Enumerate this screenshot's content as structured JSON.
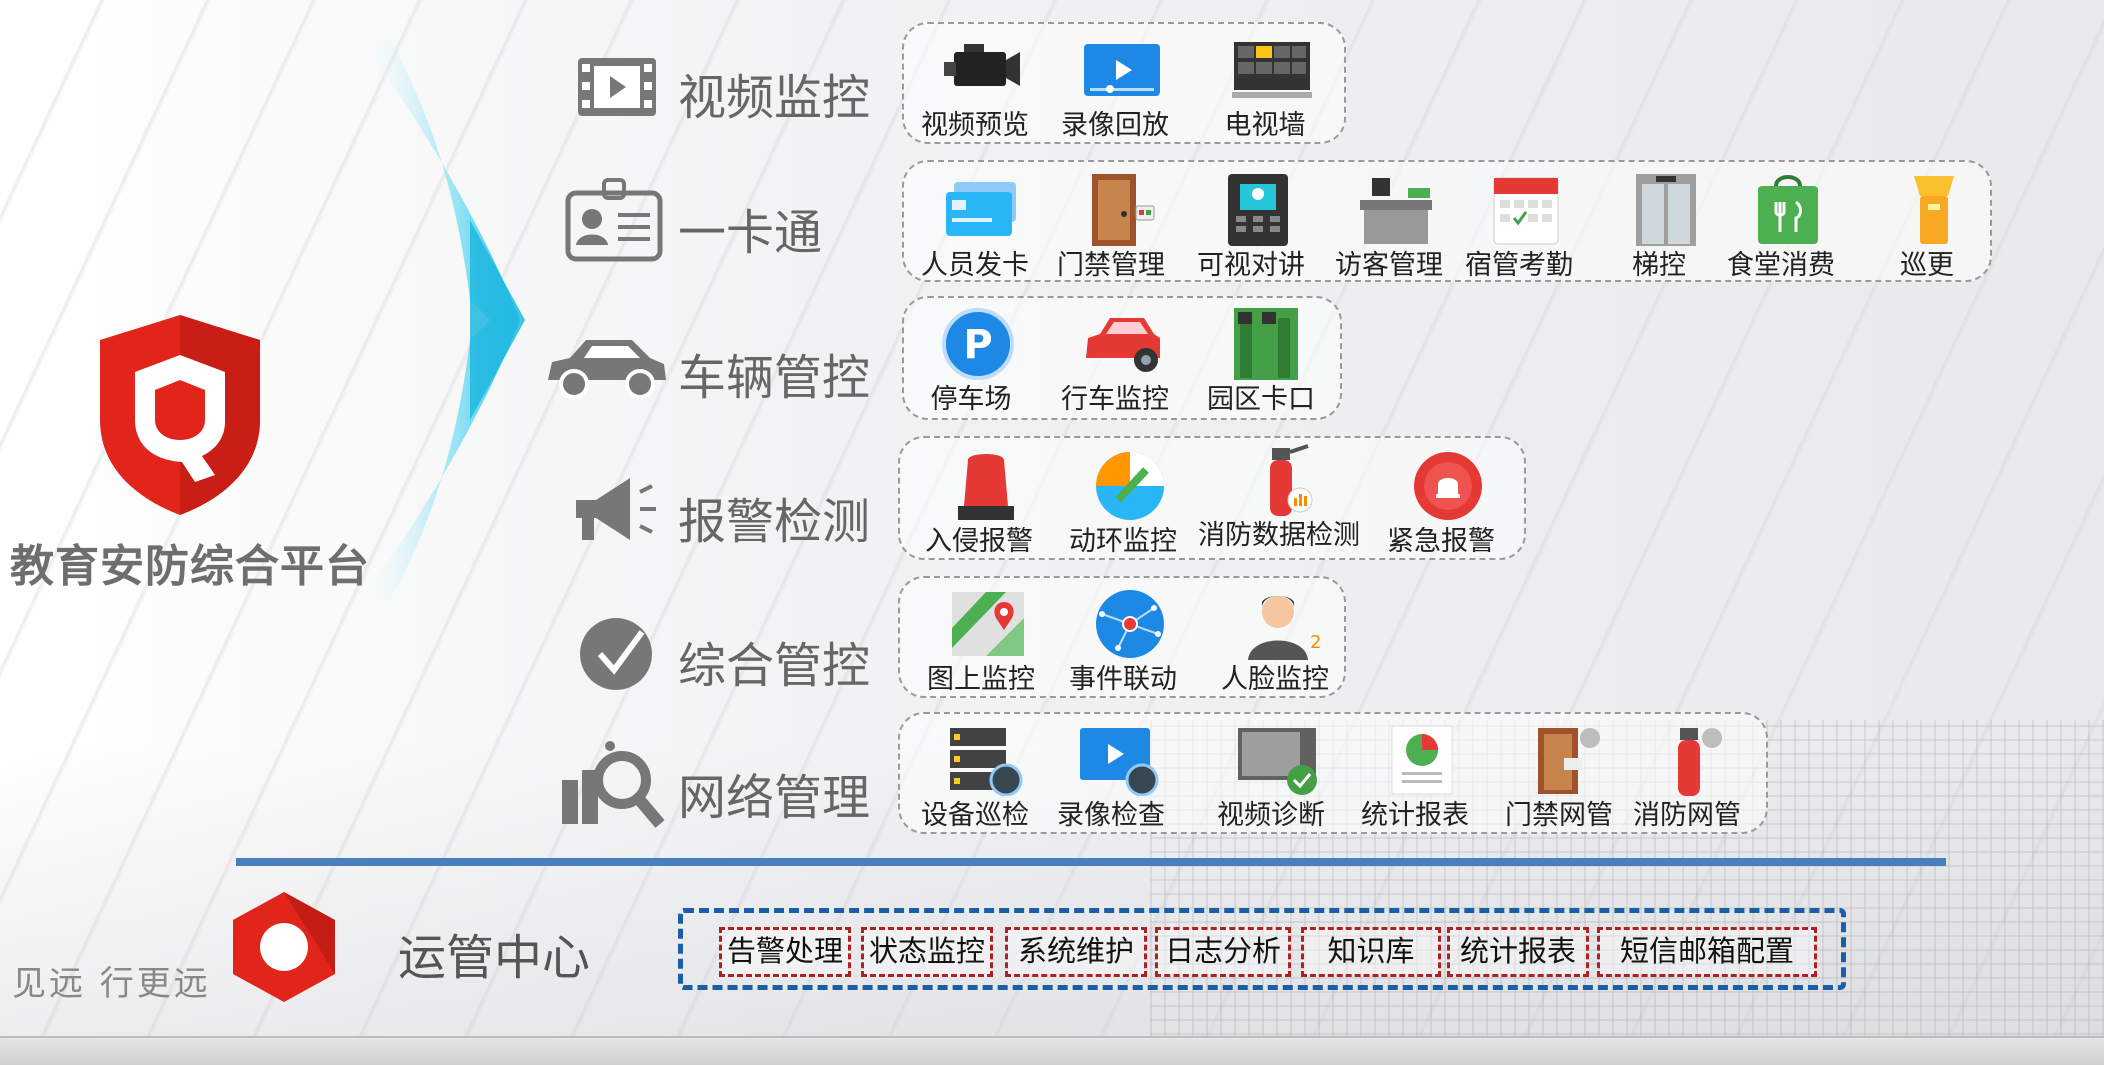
{
  "platform": {
    "title": "教育安防综合平台",
    "slogan": "见远 行更远"
  },
  "categories": [
    {
      "label": "视频监控",
      "icon": "film-icon"
    },
    {
      "label": "一卡通",
      "icon": "id-card-icon"
    },
    {
      "label": "车辆管控",
      "icon": "car-icon"
    },
    {
      "label": "报警检测",
      "icon": "megaphone-icon"
    },
    {
      "label": "综合管控",
      "icon": "check-clock-icon"
    },
    {
      "label": "网络管理",
      "icon": "magnifier-chart-icon"
    }
  ],
  "groups": {
    "video": [
      {
        "label": "视频预览",
        "icon": "video-camera-icon"
      },
      {
        "label": "录像回放",
        "icon": "playback-icon"
      },
      {
        "label": "电视墙",
        "icon": "tv-wall-icon"
      }
    ],
    "card": [
      {
        "label": "人员发卡",
        "icon": "cards-icon"
      },
      {
        "label": "门禁管理",
        "icon": "door-icon"
      },
      {
        "label": "可视对讲",
        "icon": "intercom-icon"
      },
      {
        "label": "访客管理",
        "icon": "reception-desk-icon"
      },
      {
        "label": "宿管考勤",
        "icon": "calendar-icon"
      },
      {
        "label": "梯控",
        "icon": "elevator-icon"
      },
      {
        "label": "食堂消费",
        "icon": "canteen-bag-icon"
      },
      {
        "label": "巡更",
        "icon": "flashlight-icon"
      }
    ],
    "vehicle": [
      {
        "label": "停车场",
        "icon": "parking-icon"
      },
      {
        "label": "行车监控",
        "icon": "car-camera-icon"
      },
      {
        "label": "园区卡口",
        "icon": "gate-icon"
      }
    ],
    "alarm": [
      {
        "label": "入侵报警",
        "icon": "siren-icon"
      },
      {
        "label": "动环监控",
        "icon": "environment-icon"
      },
      {
        "label": "消防数据检测",
        "icon": "fire-extinguisher-icon"
      },
      {
        "label": "紧急报警",
        "icon": "emergency-bell-icon"
      }
    ],
    "integrated": [
      {
        "label": "图上监控",
        "icon": "map-icon"
      },
      {
        "label": "事件联动",
        "icon": "network-globe-icon"
      },
      {
        "label": "人脸监控",
        "icon": "face-user-icon"
      }
    ],
    "network": [
      {
        "label": "设备巡检",
        "icon": "server-inspect-icon"
      },
      {
        "label": "录像检查",
        "icon": "video-check-icon"
      },
      {
        "label": "视频诊断",
        "icon": "video-diagnosis-icon"
      },
      {
        "label": "统计报表",
        "icon": "pie-report-icon"
      },
      {
        "label": "门禁网管",
        "icon": "door-gear-icon"
      },
      {
        "label": "消防网管",
        "icon": "extinguisher-gear-icon"
      }
    ]
  },
  "ops_center": {
    "title": "运管中心",
    "items": [
      "告警处理",
      "状态监控",
      "系统维护",
      "日志分析",
      "知识库",
      "统计报表",
      "短信邮箱配置"
    ]
  },
  "colors": {
    "brand_red": "#e1251b",
    "divider_blue": "#4a7ebf",
    "ops_blue": "#1a5ea8",
    "ops_red": "#b01f24",
    "arrow_cyan": "#2fc6e8"
  }
}
